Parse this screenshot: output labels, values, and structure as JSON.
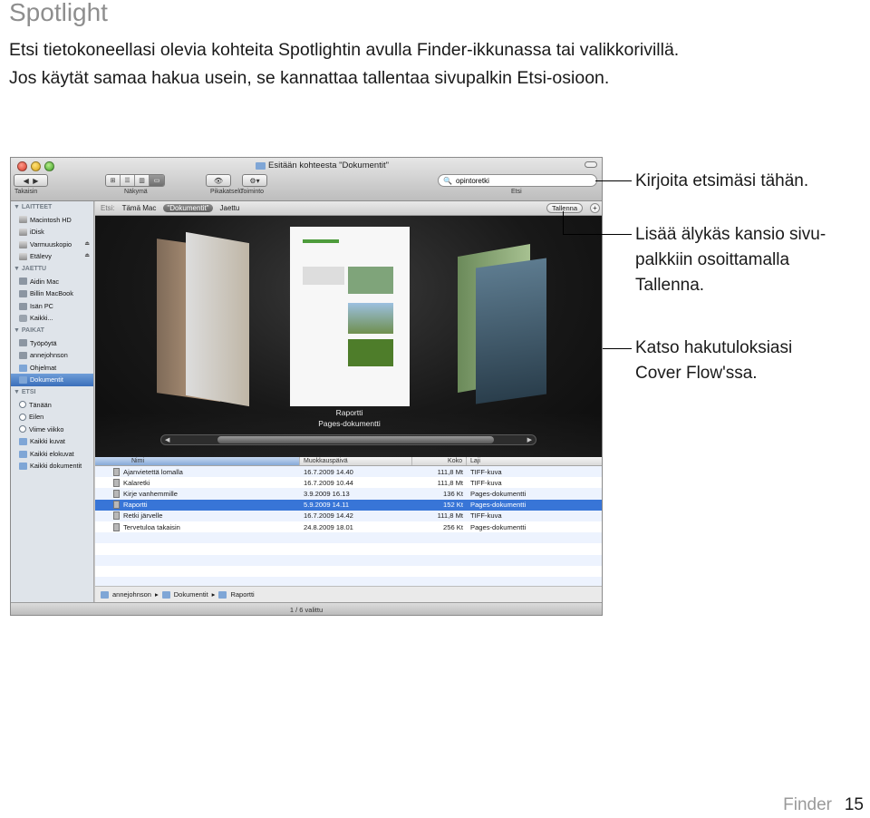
{
  "heading": "Spotlight",
  "intro": [
    "Etsi tietokoneellasi olevia kohteita Spotlightin avulla Finder-ikkunassa tai valikkorivillä.",
    "Jos käytät samaa hakua usein, se kannattaa tallentaa sivupalkin Etsi-osioon."
  ],
  "window": {
    "title": "Esitään kohteesta \"Dokumentit\"",
    "toolbar": {
      "back_label": "Takaisin",
      "view_label": "Näkymä",
      "quicklook_label": "Pikakatselu",
      "action_label": "Toiminto",
      "search_label": "Etsi",
      "search_value": "opintoretki"
    },
    "sidebar": {
      "sections": [
        {
          "title": "▼ LAITTEET",
          "items": [
            {
              "label": "Macintosh HD",
              "icon": "disk-icon"
            },
            {
              "label": "iDisk",
              "icon": "idisk-icon"
            },
            {
              "label": "Varmuuskopio",
              "icon": "backup-disk-icon",
              "eject": true
            },
            {
              "label": "Etälevy",
              "icon": "remote-disk-icon",
              "eject": true
            }
          ]
        },
        {
          "title": "▼ JAETTU",
          "items": [
            {
              "label": "Aidin Mac",
              "icon": "computer-icon"
            },
            {
              "label": "Billin MacBook",
              "icon": "laptop-icon"
            },
            {
              "label": "Isän PC",
              "icon": "pc-icon"
            },
            {
              "label": "Kaikki...",
              "icon": "network-icon"
            }
          ]
        },
        {
          "title": "▼ PAIKAT",
          "items": [
            {
              "label": "Työpöytä",
              "icon": "desktop-icon"
            },
            {
              "label": "annejohnson",
              "icon": "home-icon"
            },
            {
              "label": "Ohjelmat",
              "icon": "applications-icon"
            },
            {
              "label": "Dokumentit",
              "icon": "folder-icon",
              "selected": true
            }
          ]
        },
        {
          "title": "▼ ETSI",
          "items": [
            {
              "label": "Tänään",
              "icon": "clock-icon"
            },
            {
              "label": "Eilen",
              "icon": "clock-icon"
            },
            {
              "label": "Viime viikko",
              "icon": "clock-icon"
            },
            {
              "label": "Kaikki kuvat",
              "icon": "smart-folder-icon"
            },
            {
              "label": "Kaikki elokuvat",
              "icon": "smart-folder-icon"
            },
            {
              "label": "Kaikki dokumentit",
              "icon": "smart-folder-icon"
            }
          ]
        }
      ]
    },
    "scope": {
      "label": "Etsi:",
      "options": [
        "Tämä Mac",
        "\"Dokumentit\"",
        "Jaettu"
      ],
      "save_label": "Tallenna",
      "add_label": "+"
    },
    "coverflow": {
      "title": "Raportti",
      "subtitle": "Pages-dokumentti"
    },
    "columns": [
      "Nimi",
      "Muokkauspäivä",
      "Koko",
      "Laji"
    ],
    "rows": [
      {
        "name": "Ajanvietettä lomalla",
        "date": "16.7.2009 14.40",
        "size": "111,8 Mt",
        "kind": "TIFF-kuva"
      },
      {
        "name": "Kalaretki",
        "date": "16.7.2009 10.44",
        "size": "111,8 Mt",
        "kind": "TIFF-kuva"
      },
      {
        "name": "Kirje vanhemmille",
        "date": "3.9.2009 16.13",
        "size": "136 Kt",
        "kind": "Pages-dokumentti"
      },
      {
        "name": "Raportti",
        "date": "5.9.2009 14.11",
        "size": "152 Kt",
        "kind": "Pages-dokumentti",
        "selected": true
      },
      {
        "name": "Retki järvelle",
        "date": "16.7.2009 14.42",
        "size": "111,8 Mt",
        "kind": "TIFF-kuva"
      },
      {
        "name": "Tervetuloa takaisin",
        "date": "24.8.2009 18.01",
        "size": "256 Kt",
        "kind": "Pages-dokumentti"
      }
    ],
    "path": [
      "annejohnson",
      "Dokumentit",
      "Raportti"
    ],
    "status": "1 / 6 valittu"
  },
  "callouts": [
    "Kirjoita etsimäsi tähän.",
    "Lisää älykäs kansio sivu-\npalkkiin osoittamalla\nTallenna.",
    "Katso hakutuloksiasi\nCover Flow'ssa."
  ],
  "footer": {
    "section": "Finder",
    "page": "15"
  },
  "colors": {
    "selection": "#3875d7",
    "sidebar_bg": "#dfe4ea",
    "heading": "#8e8e8e"
  }
}
